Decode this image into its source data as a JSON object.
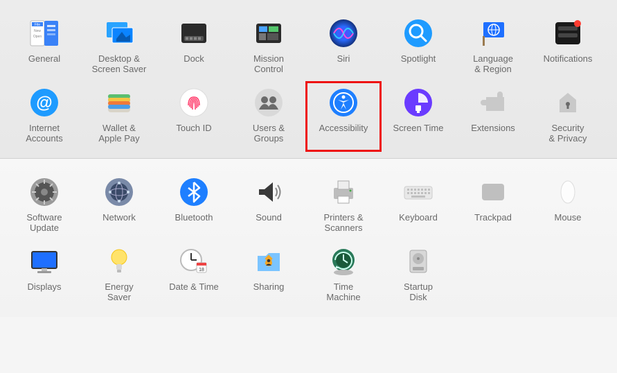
{
  "sections": [
    {
      "rows": [
        [
          {
            "id": "general",
            "label": "General"
          },
          {
            "id": "desktop",
            "label": "Desktop &\nScreen Saver"
          },
          {
            "id": "dock",
            "label": "Dock"
          },
          {
            "id": "mission",
            "label": "Mission\nControl"
          },
          {
            "id": "siri",
            "label": "Siri"
          },
          {
            "id": "spotlight",
            "label": "Spotlight"
          },
          {
            "id": "language",
            "label": "Language\n& Region"
          },
          {
            "id": "notifications",
            "label": "Notifications"
          }
        ],
        [
          {
            "id": "internet",
            "label": "Internet\nAccounts"
          },
          {
            "id": "wallet",
            "label": "Wallet &\nApple Pay"
          },
          {
            "id": "touchid",
            "label": "Touch ID"
          },
          {
            "id": "users",
            "label": "Users &\nGroups"
          },
          {
            "id": "accessibility",
            "label": "Accessibility",
            "highlight": true
          },
          {
            "id": "screentime",
            "label": "Screen Time"
          },
          {
            "id": "extensions",
            "label": "Extensions"
          },
          {
            "id": "security",
            "label": "Security\n& Privacy"
          }
        ]
      ]
    },
    {
      "rows": [
        [
          {
            "id": "software",
            "label": "Software\nUpdate"
          },
          {
            "id": "network",
            "label": "Network"
          },
          {
            "id": "bluetooth",
            "label": "Bluetooth"
          },
          {
            "id": "sound",
            "label": "Sound"
          },
          {
            "id": "printers",
            "label": "Printers &\nScanners"
          },
          {
            "id": "keyboard",
            "label": "Keyboard"
          },
          {
            "id": "trackpad",
            "label": "Trackpad"
          },
          {
            "id": "mouse",
            "label": "Mouse"
          }
        ],
        [
          {
            "id": "displays",
            "label": "Displays"
          },
          {
            "id": "energy",
            "label": "Energy\nSaver"
          },
          {
            "id": "datetime",
            "label": "Date & Time"
          },
          {
            "id": "sharing",
            "label": "Sharing"
          },
          {
            "id": "timemachine",
            "label": "Time\nMachine"
          },
          {
            "id": "startupdisk",
            "label": "Startup\nDisk"
          }
        ]
      ]
    }
  ]
}
